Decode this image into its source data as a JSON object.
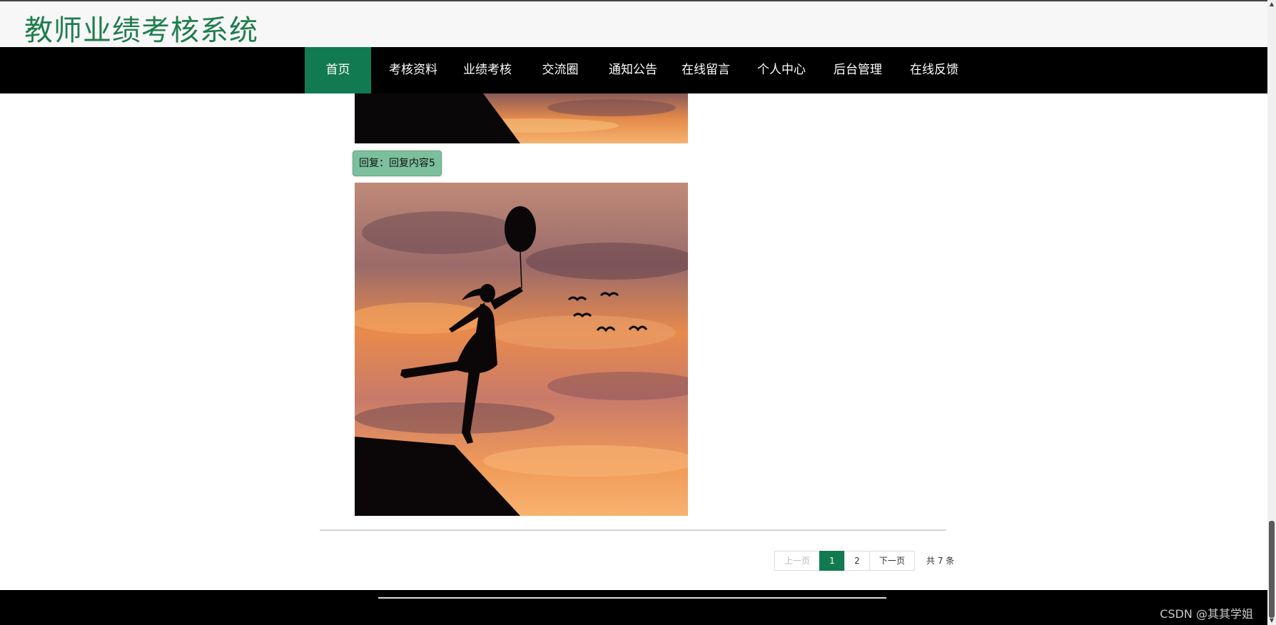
{
  "app": {
    "title": "教师业绩考核系统"
  },
  "nav": {
    "items": [
      {
        "label": "首页",
        "active": true
      },
      {
        "label": "考核资料"
      },
      {
        "label": "业绩考核"
      },
      {
        "label": "交流圈"
      },
      {
        "label": "通知公告"
      },
      {
        "label": "在线留言"
      },
      {
        "label": "个人中心"
      },
      {
        "label": "后台管理"
      },
      {
        "label": "在线反馈"
      }
    ]
  },
  "content": {
    "reply_text": "回复：回复内容5",
    "images": [
      {
        "name": "reply-image-cropped",
        "subject": "girl-with-balloon-sunset-silhouette"
      },
      {
        "name": "reply-image",
        "subject": "girl-with-balloon-sunset-silhouette"
      }
    ]
  },
  "pagination": {
    "prev": "上一页",
    "pages": [
      "1",
      "2"
    ],
    "current_page": "1",
    "next": "下一页",
    "total": "共 7 条"
  },
  "footer": {
    "watermark": "CSDN @其其学姐"
  },
  "colors": {
    "brand_green": "#127a50",
    "title_green": "#1f7e4e",
    "badge_green": "#7bbf9d"
  }
}
